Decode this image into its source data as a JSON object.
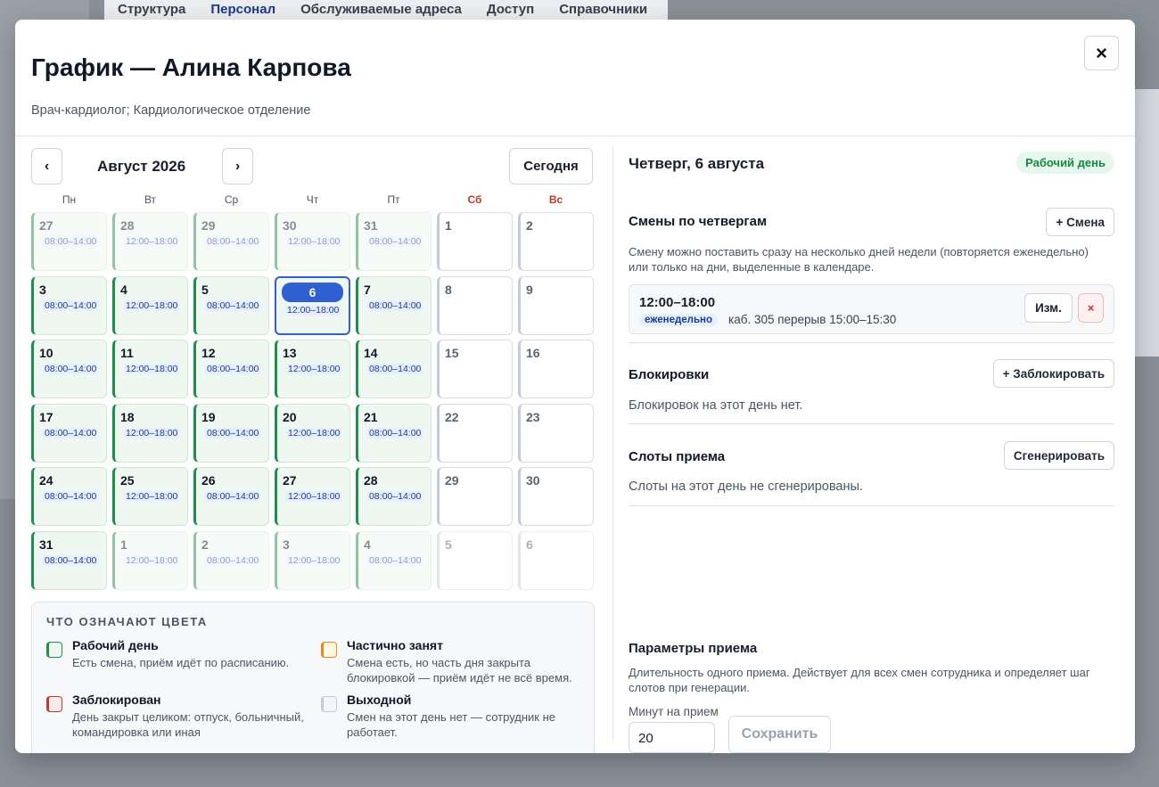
{
  "background": {
    "tabs": [
      {
        "label": "Структура"
      },
      {
        "label": "Персонал"
      },
      {
        "label": "Обслуживаемые адреса"
      },
      {
        "label": "Доступ"
      },
      {
        "label": "Справочники"
      }
    ]
  },
  "modal": {
    "title": "График — Алина Карпова",
    "subtitle": "Врач-кардиолог; Кардиологическое отделение",
    "close_label": "×"
  },
  "calendar": {
    "prev_label": "‹",
    "next_label": "›",
    "month": "Август 2026",
    "today_label": "Сегодня",
    "weekdays": [
      "Пн",
      "Вт",
      "Ср",
      "Чт",
      "Пт",
      "Сб",
      "Вс"
    ],
    "days": [
      {
        "n": "27",
        "t": "08:00–14:00",
        "s": "work",
        "o": true
      },
      {
        "n": "28",
        "t": "12:00–18:00",
        "s": "work",
        "o": true
      },
      {
        "n": "29",
        "t": "08:00–14:00",
        "s": "work",
        "o": true
      },
      {
        "n": "30",
        "t": "12:00–18:00",
        "s": "work",
        "o": true
      },
      {
        "n": "31",
        "t": "08:00–14:00",
        "s": "work",
        "o": true
      },
      {
        "n": "1",
        "t": "",
        "s": "off",
        "o": false
      },
      {
        "n": "2",
        "t": "",
        "s": "off",
        "o": false
      },
      {
        "n": "3",
        "t": "08:00–14:00",
        "s": "work",
        "o": false
      },
      {
        "n": "4",
        "t": "12:00–18:00",
        "s": "work",
        "o": false
      },
      {
        "n": "5",
        "t": "08:00–14:00",
        "s": "work",
        "o": false
      },
      {
        "n": "6",
        "t": "12:00–18:00",
        "s": "work",
        "o": false,
        "sel": true
      },
      {
        "n": "7",
        "t": "08:00–14:00",
        "s": "work",
        "o": false
      },
      {
        "n": "8",
        "t": "",
        "s": "off",
        "o": false
      },
      {
        "n": "9",
        "t": "",
        "s": "off",
        "o": false
      },
      {
        "n": "10",
        "t": "08:00–14:00",
        "s": "work",
        "o": false
      },
      {
        "n": "11",
        "t": "12:00–18:00",
        "s": "work",
        "o": false
      },
      {
        "n": "12",
        "t": "08:00–14:00",
        "s": "work",
        "o": false
      },
      {
        "n": "13",
        "t": "12:00–18:00",
        "s": "work",
        "o": false
      },
      {
        "n": "14",
        "t": "08:00–14:00",
        "s": "work",
        "o": false
      },
      {
        "n": "15",
        "t": "",
        "s": "off",
        "o": false
      },
      {
        "n": "16",
        "t": "",
        "s": "off",
        "o": false
      },
      {
        "n": "17",
        "t": "08:00–14:00",
        "s": "work",
        "o": false
      },
      {
        "n": "18",
        "t": "12:00–18:00",
        "s": "work",
        "o": false
      },
      {
        "n": "19",
        "t": "08:00–14:00",
        "s": "work",
        "o": false
      },
      {
        "n": "20",
        "t": "12:00–18:00",
        "s": "work",
        "o": false
      },
      {
        "n": "21",
        "t": "08:00–14:00",
        "s": "work",
        "o": false
      },
      {
        "n": "22",
        "t": "",
        "s": "off",
        "o": false
      },
      {
        "n": "23",
        "t": "",
        "s": "off",
        "o": false
      },
      {
        "n": "24",
        "t": "08:00–14:00",
        "s": "work",
        "o": false
      },
      {
        "n": "25",
        "t": "12:00–18:00",
        "s": "work",
        "o": false
      },
      {
        "n": "26",
        "t": "08:00–14:00",
        "s": "work",
        "o": false
      },
      {
        "n": "27",
        "t": "12:00–18:00",
        "s": "work",
        "o": false
      },
      {
        "n": "28",
        "t": "08:00–14:00",
        "s": "work",
        "o": false
      },
      {
        "n": "29",
        "t": "",
        "s": "off",
        "o": false
      },
      {
        "n": "30",
        "t": "",
        "s": "off",
        "o": false
      },
      {
        "n": "31",
        "t": "08:00–14:00",
        "s": "work",
        "o": false
      },
      {
        "n": "1",
        "t": "12:00–18:00",
        "s": "work",
        "o": true
      },
      {
        "n": "2",
        "t": "08:00–14:00",
        "s": "work",
        "o": true
      },
      {
        "n": "3",
        "t": "12:00–18:00",
        "s": "work",
        "o": true
      },
      {
        "n": "4",
        "t": "08:00–14:00",
        "s": "work",
        "o": true
      },
      {
        "n": "5",
        "t": "",
        "s": "off",
        "o": true
      },
      {
        "n": "6",
        "t": "",
        "s": "off",
        "o": true
      }
    ]
  },
  "legend": {
    "title": "ЧТО ОЗНАЧАЮТ ЦВЕТА",
    "items": [
      {
        "name": "Рабочий день",
        "desc": "Есть смена, приём идёт по расписанию.",
        "color": "#1f8f4e",
        "bg": "#eef8f1"
      },
      {
        "name": "Частично занят",
        "desc": "Смена есть, но часть дня закрыта блокировкой — приём идёт не всё время.",
        "color": "#e38a1a",
        "bg": "#fff6e6"
      },
      {
        "name": "Заблокирован",
        "desc": "День закрыт целиком: отпуск, больничный, командировка или иная",
        "color": "#c0392b",
        "bg": "#fdeaea"
      },
      {
        "name": "Выходной",
        "desc": "Смен на этот день нет — сотрудник не работает.",
        "color": "#c3ccd8",
        "bg": "#f3f5f8"
      }
    ]
  },
  "day": {
    "title": "Четверг, 6 августа",
    "badge": "Рабочий день",
    "shifts": {
      "title": "Смены по четвергам",
      "add_label": "+ Смена",
      "hint": "Смену можно поставить сразу на несколько дней недели (повторяется еженедельно) или только на дни, выделенные в календаре.",
      "item": {
        "time": "12:00–18:00",
        "repeat": "еженедельно",
        "info": "каб. 305  перерыв 15:00–15:30",
        "edit_label": "Изм.",
        "delete_label": "×"
      }
    },
    "blocks": {
      "title": "Блокировки",
      "add_label": "+ Заблокировать",
      "empty": "Блокировок на этот день нет."
    },
    "slots": {
      "title": "Слоты приема",
      "gen_label": "Сгенерировать",
      "empty": "Слоты на этот день не сгенерированы."
    },
    "params": {
      "title": "Параметры приема",
      "hint": "Длительность одного приема. Действует для всех смен сотрудника и определяет шаг слотов при генерации.",
      "field_label": "Минут на прием",
      "value": "20",
      "save_label": "Сохранить"
    }
  }
}
